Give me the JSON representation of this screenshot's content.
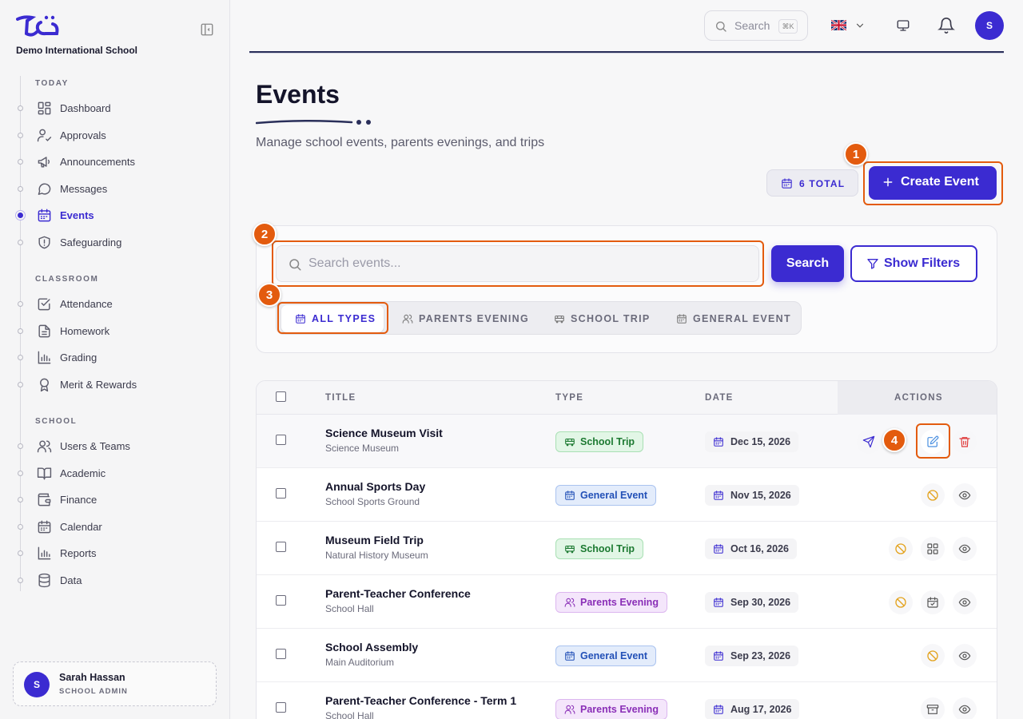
{
  "app": {
    "school_name": "Demo International School",
    "colors": {
      "accent": "#3b2bd1",
      "highlight": "#e35b0e"
    }
  },
  "sidebar": {
    "sections": [
      {
        "title": "TODAY",
        "items": [
          {
            "label": "Dashboard",
            "icon": "dashboard-icon",
            "active": false
          },
          {
            "label": "Approvals",
            "icon": "user-check-icon",
            "active": false
          },
          {
            "label": "Announcements",
            "icon": "megaphone-icon",
            "active": false
          },
          {
            "label": "Messages",
            "icon": "message-icon",
            "active": false
          },
          {
            "label": "Events",
            "icon": "calendar-icon",
            "active": true
          },
          {
            "label": "Safeguarding",
            "icon": "shield-icon",
            "active": false
          }
        ]
      },
      {
        "title": "CLASSROOM",
        "items": [
          {
            "label": "Attendance",
            "icon": "checkbox-icon",
            "active": false
          },
          {
            "label": "Homework",
            "icon": "document-icon",
            "active": false
          },
          {
            "label": "Grading",
            "icon": "bar-chart-icon",
            "active": false
          },
          {
            "label": "Merit & Rewards",
            "icon": "award-icon",
            "active": false
          }
        ]
      },
      {
        "title": "SCHOOL",
        "items": [
          {
            "label": "Users & Teams",
            "icon": "users-icon",
            "active": false
          },
          {
            "label": "Academic",
            "icon": "book-icon",
            "active": false
          },
          {
            "label": "Finance",
            "icon": "wallet-icon",
            "active": false
          },
          {
            "label": "Calendar",
            "icon": "calendar-icon",
            "active": false
          },
          {
            "label": "Reports",
            "icon": "bar-chart-icon",
            "active": false
          },
          {
            "label": "Data",
            "icon": "database-icon",
            "active": false
          }
        ]
      }
    ],
    "profile": {
      "initial": "S",
      "name": "Sarah Hassan",
      "role": "SCHOOL ADMIN"
    }
  },
  "topbar": {
    "search_placeholder": "Search",
    "shortcut": "⌘K",
    "language_flag": "uk-flag-icon",
    "avatar_initial": "S"
  },
  "page": {
    "title": "Events",
    "subtitle": "Manage school events, parents evenings, and trips",
    "total_badge": "6 TOTAL",
    "create_button": "Create Event"
  },
  "filters": {
    "search_placeholder": "Search events...",
    "search_button": "Search",
    "show_filters_button": "Show Filters",
    "types": [
      {
        "label": "ALL TYPES",
        "active": true
      },
      {
        "label": "PARENTS EVENING",
        "active": false
      },
      {
        "label": "SCHOOL TRIP",
        "active": false
      },
      {
        "label": "GENERAL EVENT",
        "active": false
      }
    ]
  },
  "annotations": [
    "1",
    "2",
    "3",
    "4"
  ],
  "table": {
    "columns": [
      "TITLE",
      "TYPE",
      "DATE",
      "ACTIONS"
    ],
    "rows": [
      {
        "title": "Science Museum Visit",
        "location": "Science Museum",
        "type": "School Trip",
        "date": "Dec 15, 2026",
        "actions": [
          "send-icon",
          "edit-icon",
          "trash-icon"
        ]
      },
      {
        "title": "Annual Sports Day",
        "location": "School Sports Ground",
        "type": "General Event",
        "date": "Nov 15, 2026",
        "actions": [
          "ban-icon",
          "eye-icon"
        ]
      },
      {
        "title": "Museum Field Trip",
        "location": "Natural History Museum",
        "type": "School Trip",
        "date": "Oct 16, 2026",
        "actions": [
          "ban-icon",
          "grid-icon",
          "eye-icon"
        ]
      },
      {
        "title": "Parent-Teacher Conference",
        "location": "School Hall",
        "type": "Parents Evening",
        "date": "Sep 30, 2026",
        "actions": [
          "ban-icon",
          "calendar-check-icon",
          "eye-icon"
        ]
      },
      {
        "title": "School Assembly",
        "location": "Main Auditorium",
        "type": "General Event",
        "date": "Sep 23, 2026",
        "actions": [
          "ban-icon",
          "eye-icon"
        ]
      },
      {
        "title": "Parent-Teacher Conference - Term 1",
        "location": "School Hall",
        "type": "Parents Evening",
        "date": "Aug 17, 2026",
        "actions": [
          "archive-icon",
          "eye-icon"
        ]
      }
    ]
  }
}
